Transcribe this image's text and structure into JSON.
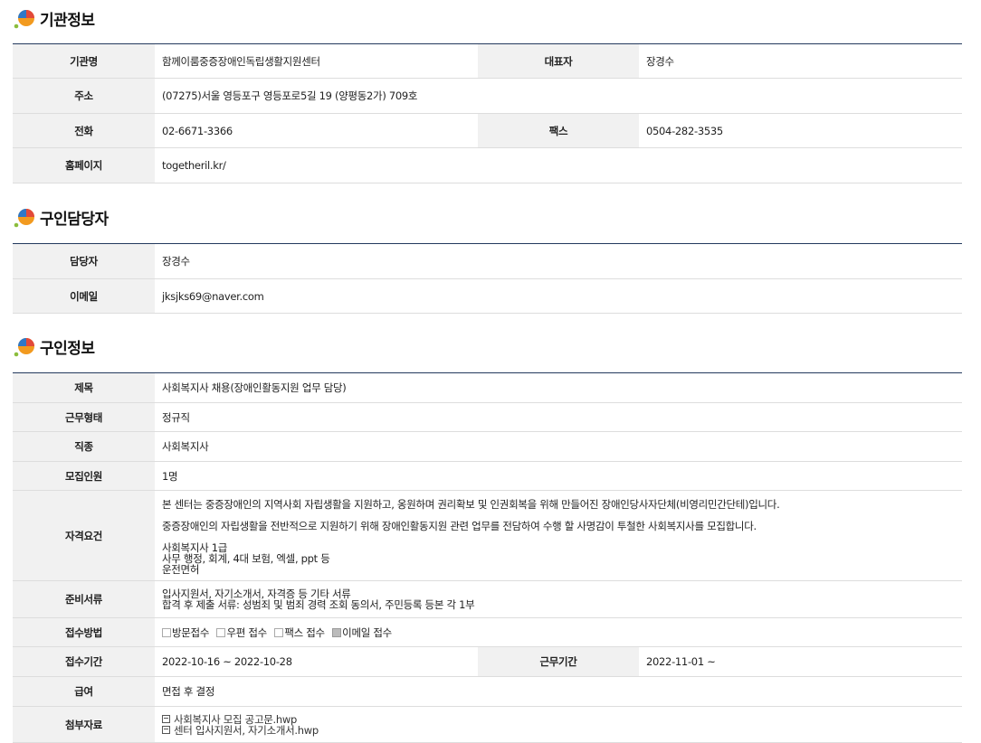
{
  "sections": {
    "org": {
      "title": "기관정보",
      "labels": {
        "name": "기관명",
        "rep": "대표자",
        "address": "주소",
        "phone": "전화",
        "fax": "팩스",
        "homepage": "홈페이지"
      },
      "values": {
        "name": "함께이룸중증장애인독립생활지원센터",
        "rep": "장경수",
        "address": "(07275)서울 영등포구 영등포로5길 19 (양평동2가) 709호",
        "phone": "02-6671-3366",
        "fax": "0504-282-3535",
        "homepage": "togetheril.kr/"
      }
    },
    "contact": {
      "title": "구인담당자",
      "labels": {
        "manager": "담당자",
        "email": "이메일"
      },
      "values": {
        "manager": "장경수",
        "email": "jksjks69@naver.com"
      }
    },
    "job": {
      "title": "구인정보",
      "labels": {
        "subject": "제목",
        "work_type": "근무형태",
        "occupation": "직종",
        "openings": "모집인원",
        "qualification": "자격요건",
        "documents": "준비서류",
        "method": "접수방법",
        "period": "접수기간",
        "work_period": "근무기간",
        "salary": "급여",
        "attachments": "첨부자료"
      },
      "values": {
        "subject": "사회복지사 채용(장애인활동지원 업무 담당)",
        "work_type": "정규직",
        "occupation": "사회복지사",
        "openings": "1명",
        "qualification": {
          "para1": "본 센터는 중증장애인의 지역사회 자립생활을 지원하고, 옹원하며 권리확보 및 인권회복을 위해 만들어진 장애인당사자단체(비영리민간단테)입니다.",
          "para2": "중증장애인의 자립생활을 전반적으로 지원하기 위해 장애인활동지원 관련 업무를 전담하여 수행 할 사명감이 투철한 사회복지사를 모집합니다.",
          "lines": [
            "사회복지사 1급",
            "사무 행정, 회계, 4대 보험, 엑셀, ppt 등",
            "운전면허"
          ]
        },
        "documents": [
          "입사지원서, 자기소개서, 자격증 등 기타 서류",
          "합격 후 제출 서류: 성범죄 및 범죄 경력 조회 동의서, 주민등록 등본 각 1부"
        ],
        "methods": [
          {
            "label": "방문접수",
            "checked": false
          },
          {
            "label": "우편 접수",
            "checked": false
          },
          {
            "label": "팩스 접수",
            "checked": false
          },
          {
            "label": "이메일 접수",
            "checked": true
          }
        ],
        "period": "2022-10-16 ~ 2022-10-28",
        "work_period": "2022-11-01 ~",
        "salary": "면접 후 결정",
        "attachments": [
          {
            "name": "사회복지사 모집 공고문.hwp",
            "icon": "file-icon"
          },
          {
            "name": "센터 입사지원서, 자기소개서.hwp",
            "icon": "file-icon"
          }
        ]
      }
    }
  },
  "colors": {
    "header_line": "#23395d",
    "label_bg": "#f1f1f1",
    "logo_blue": "#2e78c8",
    "logo_orange": "#f29a1f",
    "logo_red": "#e2493a",
    "logo_green": "#8bbd3c"
  }
}
